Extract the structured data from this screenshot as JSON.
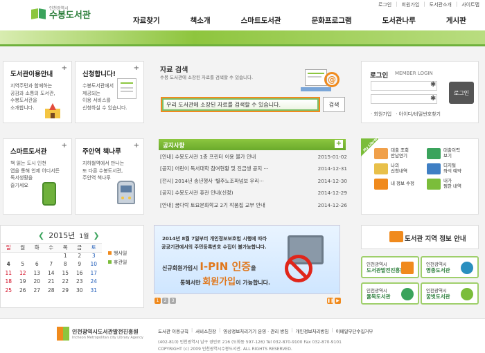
{
  "top_links": [
    "로그인",
    "회원가입",
    "도서관소개",
    "사이트맵"
  ],
  "logo": {
    "sub": "인천광역시",
    "name": "수봉도서관"
  },
  "main_nav": [
    "자료찾기",
    "책소개",
    "스마트도서관",
    "문화프로그램",
    "도서관나루",
    "게시판"
  ],
  "intro_box": {
    "title": "도서관이용안내",
    "desc": [
      "지역주민과 함께하는",
      "공감과 소통의 도서관,",
      "수봉도서관을",
      "소개합니다."
    ]
  },
  "apply_box": {
    "title": "신청합니다!",
    "desc": [
      "수봉도서관에서",
      "제공되는",
      "이용 서비스를",
      "신청하실 수 있습니다."
    ]
  },
  "smart_box": {
    "title": "스마트도서관",
    "desc": [
      "책 읽는 도시 인천",
      "앱을 통해 언제 어디서든",
      "독서생활을",
      "즐기세요"
    ]
  },
  "night_box": {
    "title": "주안역 책나루",
    "desc": [
      "지하철역에서 만나는",
      "또 다른 수봉도서관,",
      "주안역 책나루"
    ]
  },
  "search": {
    "title": "자료 검색",
    "desc": "수봉 도서관에 소장된 자료를 검색할 수 있습니다.",
    "placeholder": "우리 도서관에 소장된 자료를 검색할 수 있습니다.",
    "button": "검색"
  },
  "login": {
    "title": "로그인",
    "sub": "MEMBER LOGIN",
    "button": "로그인",
    "star": "✱",
    "links": [
      "· 회원가입",
      "· 아이디/비밀번호찾기"
    ]
  },
  "notice": {
    "title": "공지사항",
    "plus": "+",
    "items": [
      {
        "text": "[안내] 수봉도서관 1층 프린터 이용 불가 안내",
        "date": "2015-01-02"
      },
      {
        "text": "[공지] 어린이 독서대학 참여현황 및 진급생 공지 ···",
        "date": "2014-12-31"
      },
      {
        "text": "[전시] 2014년 송년행사 '별주노조파넘보 우리···",
        "date": "2014-12-30"
      },
      {
        "text": "[공지] 수봉도서관 휴관 안내(신정)",
        "date": "2014-12-29"
      },
      {
        "text": "[안내] 꿈다락 토요문화학교 2기 작품집 교부 안내",
        "date": "2014-12-26"
      }
    ]
  },
  "my_library": {
    "tag": "My Library",
    "items": [
      {
        "label": [
          "대출 조회",
          "반납연기"
        ],
        "color": "#f0a04a"
      },
      {
        "label": [
          "대출이력",
          "보기"
        ],
        "color": "#3aa35c"
      },
      {
        "label": [
          "나의",
          "신청내역"
        ],
        "color": "#e8c04a"
      },
      {
        "label": [
          "디지털",
          "좌석 예약"
        ],
        "color": "#3f7fc4"
      },
      {
        "label": [
          "내 정보 수정"
        ],
        "color": "#f08a1d"
      },
      {
        "label": [
          "내가",
          "찜한 내역"
        ],
        "color": "#7bbd3a"
      }
    ]
  },
  "calendar": {
    "year": "2015년",
    "month": "1월",
    "prev": "❮",
    "next": "❯",
    "weekdays": [
      "일",
      "월",
      "화",
      "수",
      "목",
      "금",
      "토"
    ],
    "weeks": [
      [
        "",
        "",
        "",
        "",
        "1",
        "2",
        "3"
      ],
      [
        "4",
        "5",
        "6",
        "7",
        "8",
        "9",
        "10"
      ],
      [
        "11",
        "12",
        "13",
        "14",
        "15",
        "16",
        "17"
      ],
      [
        "18",
        "19",
        "20",
        "21",
        "22",
        "23",
        "24"
      ],
      [
        "25",
        "26",
        "27",
        "28",
        "29",
        "30",
        "31"
      ]
    ],
    "legend": [
      {
        "label": "행사일",
        "color": "#f08a1d"
      },
      {
        "label": "휴관일",
        "color": "#7bbd3a"
      }
    ]
  },
  "banner": {
    "line1": "2014년 8월 7일부터 개인정보보호법 시행에 따라",
    "line2": "공공기관에서의 주민등록번호 수집이 불가능합니다.",
    "line3a": "신규회원가입시 ",
    "line3b": "I-PIN 인증",
    "line3c": "을",
    "line4a": "통해서만 ",
    "line4b": "회원가입",
    "line4c": "이 가능합니다.",
    "pages": [
      "1",
      "2",
      "3"
    ],
    "ctrl": [
      "❚❚",
      "▶"
    ]
  },
  "region": {
    "title": "도서관 지역 정보 안내",
    "libs": [
      {
        "city": "인천광역시",
        "name": "도서관발전진흥원",
        "color": "#f08a1d"
      },
      {
        "city": "인천광역시",
        "name": "영종도서관",
        "color": "#2a8fbf"
      },
      {
        "city": "인천광역시",
        "name": "율목도서관",
        "color": "#3aa35c"
      },
      {
        "city": "인천광역시",
        "name": "꿈벗도서관",
        "color": "#7bbd3a"
      }
    ]
  },
  "footer": {
    "logo_name": "인천광역시도서관발전진흥원",
    "logo_sub": "Incheon Metropolitan city Library Agency",
    "links": [
      "도서관 이용규칙",
      "서비스헌장",
      "영상정보처리기기 운영 · 관리 방침",
      "개인정보처리방침",
      "이메일무단수집거부"
    ],
    "address": "(402-810) 인천광역시 남구 경인로 216 (도화동 597-126)   Tel 032-870-9100   Fax 032-870-9101",
    "copyright": "COPYRIGHT (c) 2009  인천광역시수봉도서관. ALL RIGHTS RESERVED."
  }
}
